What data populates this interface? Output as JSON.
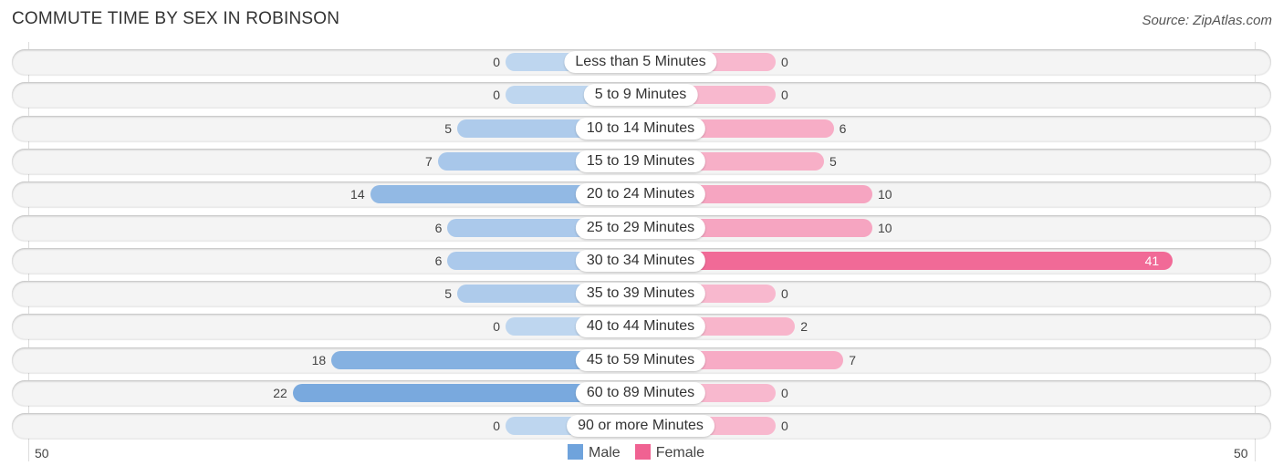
{
  "header": {
    "title": "COMMUTE TIME BY SEX IN ROBINSON",
    "source": "Source: ZipAtlas.com"
  },
  "chart_data": {
    "type": "bar",
    "title": "COMMUTE TIME BY SEX IN ROBINSON",
    "orientation": "horizontal-diverging",
    "categories": [
      "Less than 5 Minutes",
      "5 to 9 Minutes",
      "10 to 14 Minutes",
      "15 to 19 Minutes",
      "20 to 24 Minutes",
      "25 to 29 Minutes",
      "30 to 34 Minutes",
      "35 to 39 Minutes",
      "40 to 44 Minutes",
      "45 to 59 Minutes",
      "60 to 89 Minutes",
      "90 or more Minutes"
    ],
    "series": [
      {
        "name": "Male",
        "color": "#6fa3dc",
        "values": [
          0,
          0,
          5,
          7,
          14,
          6,
          6,
          5,
          0,
          18,
          22,
          0
        ]
      },
      {
        "name": "Female",
        "color": "#f06292",
        "values": [
          0,
          0,
          6,
          5,
          10,
          10,
          41,
          0,
          2,
          7,
          0,
          0
        ]
      }
    ],
    "axis": {
      "left_tick": "50",
      "right_tick": "50",
      "max": 50
    },
    "legend": {
      "position": "bottom-center",
      "items": [
        "Male",
        "Female"
      ]
    }
  }
}
